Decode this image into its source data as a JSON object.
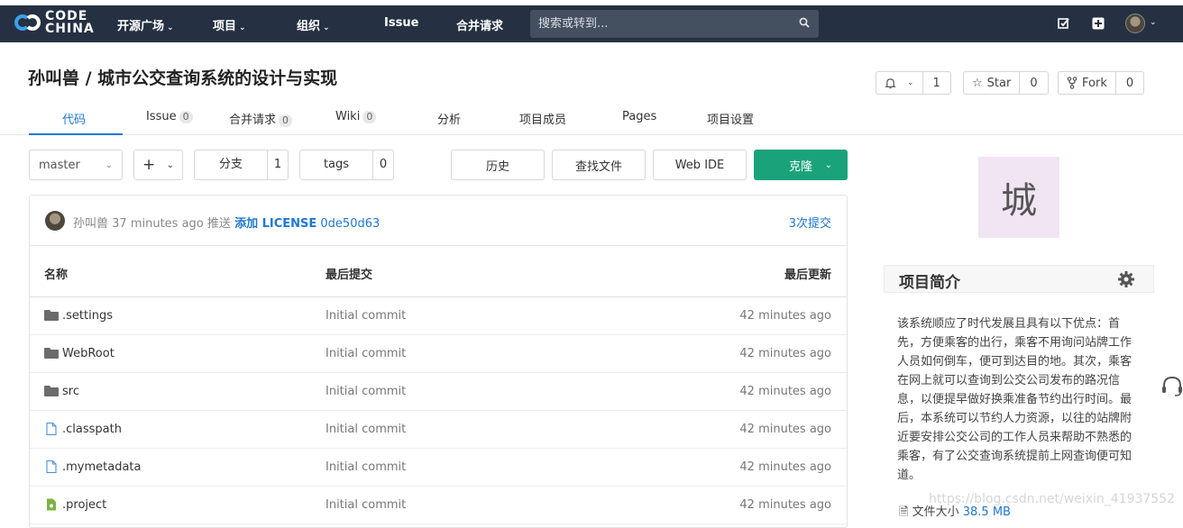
{
  "nav": {
    "logo_line1": "CODE",
    "logo_line2": "CHINA",
    "items": [
      {
        "label": "开源广场",
        "caret": "⌄"
      },
      {
        "label": "项目",
        "caret": "⌄"
      },
      {
        "label": "组织",
        "caret": "⌄"
      },
      {
        "label": "Issue",
        "caret": ""
      },
      {
        "label": "合并请求",
        "caret": ""
      }
    ],
    "search_placeholder": "搜索或转到..."
  },
  "project": {
    "title": "孙叫兽 / 城市公交查询系统的设计与实现",
    "watch": {
      "count": "1"
    },
    "star": {
      "label": "Star",
      "count": "0"
    },
    "fork": {
      "label": "Fork",
      "count": "0"
    }
  },
  "tabs": [
    {
      "label": "代码",
      "badge": ""
    },
    {
      "label": "Issue",
      "badge": "0"
    },
    {
      "label": "合并请求",
      "badge": "0"
    },
    {
      "label": "Wiki",
      "badge": "0"
    },
    {
      "label": "分析",
      "badge": ""
    },
    {
      "label": "项目成员",
      "badge": ""
    },
    {
      "label": "Pages",
      "badge": ""
    },
    {
      "label": "项目设置",
      "badge": ""
    }
  ],
  "toolbar": {
    "branch": "master",
    "add": "+",
    "branches_label": "分支",
    "branches_count": "1",
    "tags_label": "tags",
    "tags_count": "0",
    "history": "历史",
    "find_file": "查找文件",
    "web_ide": "Web IDE",
    "clone": "克隆"
  },
  "last_commit": {
    "author": "孙叫兽",
    "time": "37 minutes ago",
    "action": "推送",
    "message": "添加 LICENSE",
    "sha": "0de50d63",
    "count": "3次提交"
  },
  "table": {
    "headers": {
      "name": "名称",
      "commit": "最后提交",
      "updated": "最后更新"
    },
    "rows": [
      {
        "type": "folder",
        "name": ".settings",
        "commit": "Initial commit",
        "time": "42 minutes ago"
      },
      {
        "type": "folder",
        "name": "WebRoot",
        "commit": "Initial commit",
        "time": "42 minutes ago"
      },
      {
        "type": "folder",
        "name": "src",
        "commit": "Initial commit",
        "time": "42 minutes ago"
      },
      {
        "type": "file",
        "name": ".classpath",
        "commit": "Initial commit",
        "time": "42 minutes ago"
      },
      {
        "type": "file",
        "name": ".mymetadata",
        "commit": "Initial commit",
        "time": "42 minutes ago"
      },
      {
        "type": "project",
        "name": ".project",
        "commit": "Initial commit",
        "time": "42 minutes ago"
      }
    ]
  },
  "sidebar": {
    "avatar_char": "城",
    "about_title": "项目简介",
    "description": "该系统顺应了时代发展且具有以下优点：首先，方便乘客的出行，乘客不用询问站牌工作人员如何倒车，便可到达目的地。其次，乘客在网上就可以查询到公交公司发布的路况信息，以便提早做好换乘准备节约出行时间。最后，本系统可以节约人力资源，以往的站牌附近要安排公交公司的工作人员来帮助不熟悉的乘客，有了公交查询系统提前上网查询便可知道。",
    "filesize_label": "文件大小",
    "filesize_value": "38.5 MB"
  },
  "watermark": "https://blog.csdn.net/weixin_41937552",
  "colors": {
    "nav_bg": "#253142",
    "accent": "#1f78d1",
    "clone_green": "#1aa37a"
  }
}
